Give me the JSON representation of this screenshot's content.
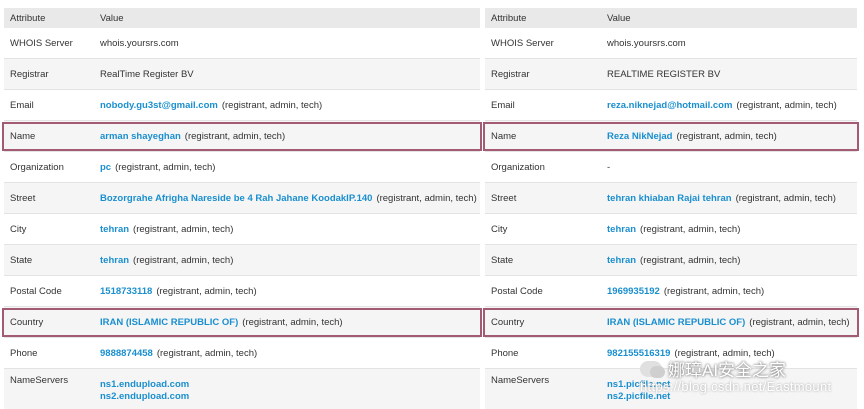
{
  "left": {
    "header": {
      "attribute": "Attribute",
      "value": "Value"
    },
    "rows": {
      "whois": {
        "label": "WHOIS Server",
        "value": "whois.yoursrs.com"
      },
      "registrar": {
        "label": "Registrar",
        "value": "RealTime Register BV"
      },
      "email": {
        "label": "Email",
        "value": "nobody.gu3st@gmail.com",
        "note": "(registrant, admin, tech)"
      },
      "name": {
        "label": "Name",
        "value": "arman shayeghan",
        "note": "(registrant, admin, tech)"
      },
      "organization": {
        "label": "Organization",
        "value": "pc",
        "note": "(registrant, admin, tech)"
      },
      "street": {
        "label": "Street",
        "value": "Bozorgrahe Afrigha Nareside be 4 Rah Jahane KoodakIP.140",
        "note": "(registrant, admin, tech)"
      },
      "city": {
        "label": "City",
        "value": "tehran",
        "note": "(registrant, admin, tech)"
      },
      "state": {
        "label": "State",
        "value": "tehran",
        "note": "(registrant, admin, tech)"
      },
      "postal": {
        "label": "Postal Code",
        "value": "1518733118",
        "note": "(registrant, admin, tech)"
      },
      "country": {
        "label": "Country",
        "value": "IRAN (ISLAMIC REPUBLIC OF)",
        "note": "(registrant, admin, tech)"
      },
      "phone": {
        "label": "Phone",
        "value": "9888874458",
        "note": "(registrant, admin, tech)"
      },
      "nameservers": {
        "label": "NameServers",
        "ns1": "ns1.endupload.com",
        "ns2": "ns2.endupload.com"
      }
    }
  },
  "right": {
    "header": {
      "attribute": "Attribute",
      "value": "Value"
    },
    "rows": {
      "whois": {
        "label": "WHOIS Server",
        "value": "whois.yoursrs.com"
      },
      "registrar": {
        "label": "Registrar",
        "value": "REALTIME REGISTER BV"
      },
      "email": {
        "label": "Email",
        "value": "reza.niknejad@hotmail.com",
        "note": "(registrant, admin, tech)"
      },
      "name": {
        "label": "Name",
        "value": "Reza NikNejad",
        "note": "(registrant, admin, tech)"
      },
      "organization": {
        "label": "Organization",
        "value": "-"
      },
      "street": {
        "label": "Street",
        "value": "tehran khiaban Rajai tehran",
        "note": "(registrant, admin, tech)"
      },
      "city": {
        "label": "City",
        "value": "tehran",
        "note": "(registrant, admin, tech)"
      },
      "state": {
        "label": "State",
        "value": "tehran",
        "note": "(registrant, admin, tech)"
      },
      "postal": {
        "label": "Postal Code",
        "value": "1969935192",
        "note": "(registrant, admin, tech)"
      },
      "country": {
        "label": "Country",
        "value": "IRAN (ISLAMIC REPUBLIC OF)",
        "note": "(registrant, admin, tech)"
      },
      "phone": {
        "label": "Phone",
        "value": "982155516319",
        "note": "(registrant, admin, tech)"
      },
      "nameservers": {
        "label": "NameServers",
        "ns1": "ns1.picfile.net",
        "ns2": "ns2.picfile.net"
      }
    }
  },
  "watermark": {
    "title": "娜璋AI安全之家",
    "url": "https://blog.csdn.net/Eastmount"
  },
  "colors": {
    "link": "#1a8fcf",
    "highlight": "#a35a73",
    "header_bg": "#e9e9e9"
  }
}
